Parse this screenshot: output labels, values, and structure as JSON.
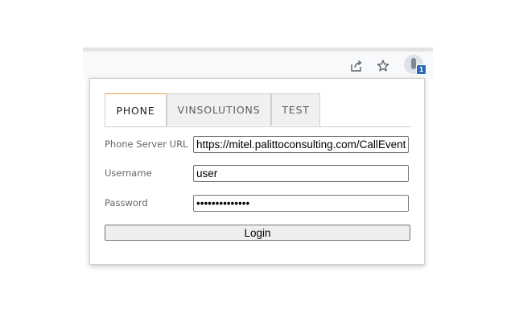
{
  "browser": {
    "share_icon": "share-icon",
    "star_icon": "star-icon",
    "extension_icon": "extension-icon",
    "extension_badge": "1"
  },
  "tabs": [
    {
      "label": "PHONE",
      "active": true
    },
    {
      "label": "VINSOLUTIONS",
      "active": false
    },
    {
      "label": "TEST",
      "active": false
    }
  ],
  "form": {
    "server_url_label": "Phone Server URL",
    "server_url_value": "https://mitel.palittoconsulting.com/CallEvents",
    "username_label": "Username",
    "username_value": "user",
    "password_label": "Password",
    "password_value": "••••••••••••••",
    "login_label": "Login"
  },
  "colors": {
    "active_tab_accent": "#e8a33d",
    "badge": "#2b6ab8"
  }
}
